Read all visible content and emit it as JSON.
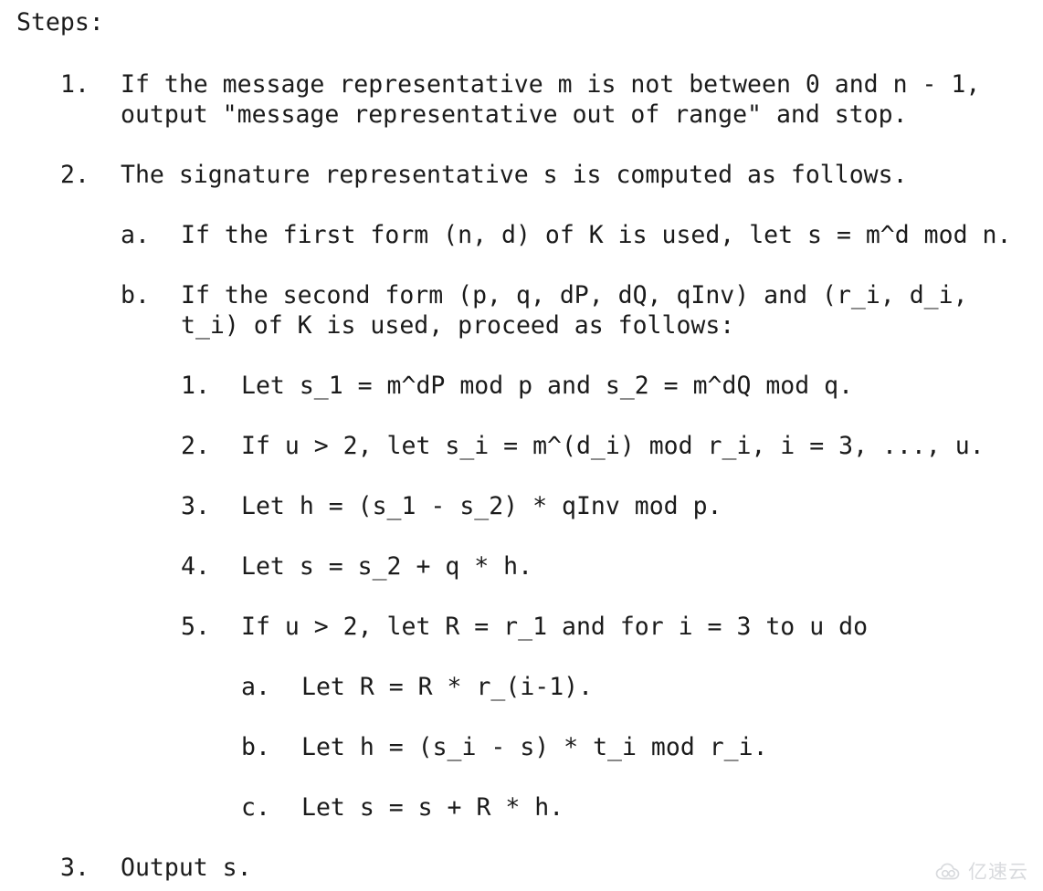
{
  "document": {
    "heading": "Steps:",
    "background_color": "#ffffff",
    "text_color": "#1b1b1b"
  },
  "steps": [
    {
      "marker": "1.",
      "level": 1,
      "lines": [
        "If the message representative m is not between 0 and n - 1,",
        "output \"message representative out of range\" and stop."
      ]
    },
    {
      "marker": "2.",
      "level": 1,
      "lines": [
        "The signature representative s is computed as follows."
      ]
    },
    {
      "marker": "a.",
      "level": 2,
      "lines": [
        "If the first form (n, d) of K is used, let s = m^d mod n."
      ]
    },
    {
      "marker": "b.",
      "level": 2,
      "lines": [
        "If the second form (p, q, dP, dQ, qInv) and (r_i, d_i,",
        "t_i) of K is used, proceed as follows:"
      ]
    },
    {
      "marker": "1.",
      "level": 3,
      "lines": [
        "Let s_1 = m^dP mod p and s_2 = m^dQ mod q."
      ]
    },
    {
      "marker": "2.",
      "level": 3,
      "lines": [
        "If u > 2, let s_i = m^(d_i) mod r_i, i = 3, ..., u."
      ]
    },
    {
      "marker": "3.",
      "level": 3,
      "lines": [
        "Let h = (s_1 - s_2) * qInv mod p."
      ]
    },
    {
      "marker": "4.",
      "level": 3,
      "lines": [
        "Let s = s_2 + q * h."
      ]
    },
    {
      "marker": "5.",
      "level": 3,
      "lines": [
        "If u > 2, let R = r_1 and for i = 3 to u do"
      ]
    },
    {
      "marker": "a.",
      "level": 4,
      "lines": [
        "Let R = R * r_(i-1)."
      ]
    },
    {
      "marker": "b.",
      "level": 4,
      "lines": [
        "Let h = (s_i - s) * t_i mod r_i."
      ]
    },
    {
      "marker": "c.",
      "level": 4,
      "lines": [
        "Let s = s + R * h."
      ]
    },
    {
      "marker": "3.",
      "level": 1,
      "lines": [
        "Output s."
      ]
    }
  ],
  "watermark": {
    "icon": "cloud-icon",
    "text": "亿速云",
    "color": "#b9bcc2"
  }
}
